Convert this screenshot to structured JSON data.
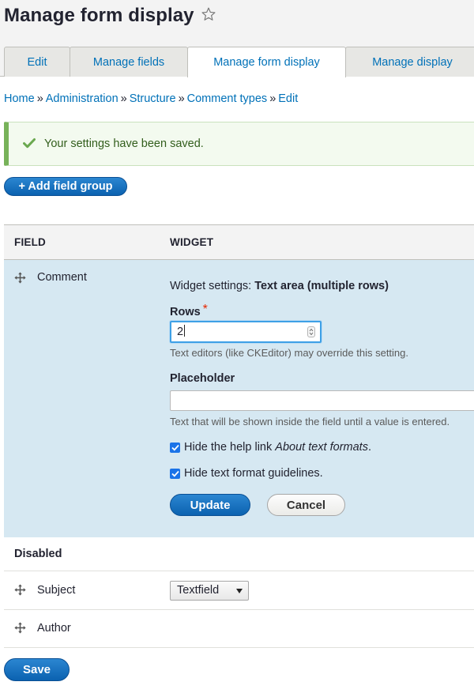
{
  "page": {
    "title": "Manage form display"
  },
  "tabs": [
    {
      "label": "Edit",
      "active": false
    },
    {
      "label": "Manage fields",
      "active": false
    },
    {
      "label": "Manage form display",
      "active": true
    },
    {
      "label": "Manage display",
      "active": false
    }
  ],
  "breadcrumb": [
    "Home",
    "Administration",
    "Structure",
    "Comment types",
    "Edit"
  ],
  "message": {
    "text": "Your settings have been saved.",
    "type": "status"
  },
  "actions": {
    "add_field_group": "+ Add field group"
  },
  "table": {
    "headers": {
      "field": "FIELD",
      "widget": "WIDGET"
    },
    "editing_row": {
      "field": "Comment",
      "widget_settings_prefix": "Widget settings:",
      "widget_name": "Text area (multiple rows)",
      "rows": {
        "label": "Rows",
        "required_mark": "*",
        "value": "2",
        "description": "Text editors (like CKEditor) may override this setting."
      },
      "placeholder": {
        "label": "Placeholder",
        "value": "",
        "description": "Text that will be shown inside the field until a value is entered."
      },
      "hide_help_link": {
        "prefix": "Hide the help link",
        "emphasis": "About text formats",
        "suffix": ".",
        "checked": true
      },
      "hide_guidelines": {
        "label": "Hide text format guidelines.",
        "checked": true
      },
      "update_label": "Update",
      "cancel_label": "Cancel"
    },
    "disabled_region": {
      "title": "Disabled",
      "rows": [
        {
          "field": "Subject",
          "widget": "Textfield"
        },
        {
          "field": "Author",
          "widget": ""
        }
      ]
    }
  },
  "form": {
    "save_label": "Save"
  },
  "colors": {
    "link": "#0071b8",
    "primary_button": "#0b62b0",
    "status_border": "#77b259",
    "edit_row_bg": "#d6e8f2"
  }
}
